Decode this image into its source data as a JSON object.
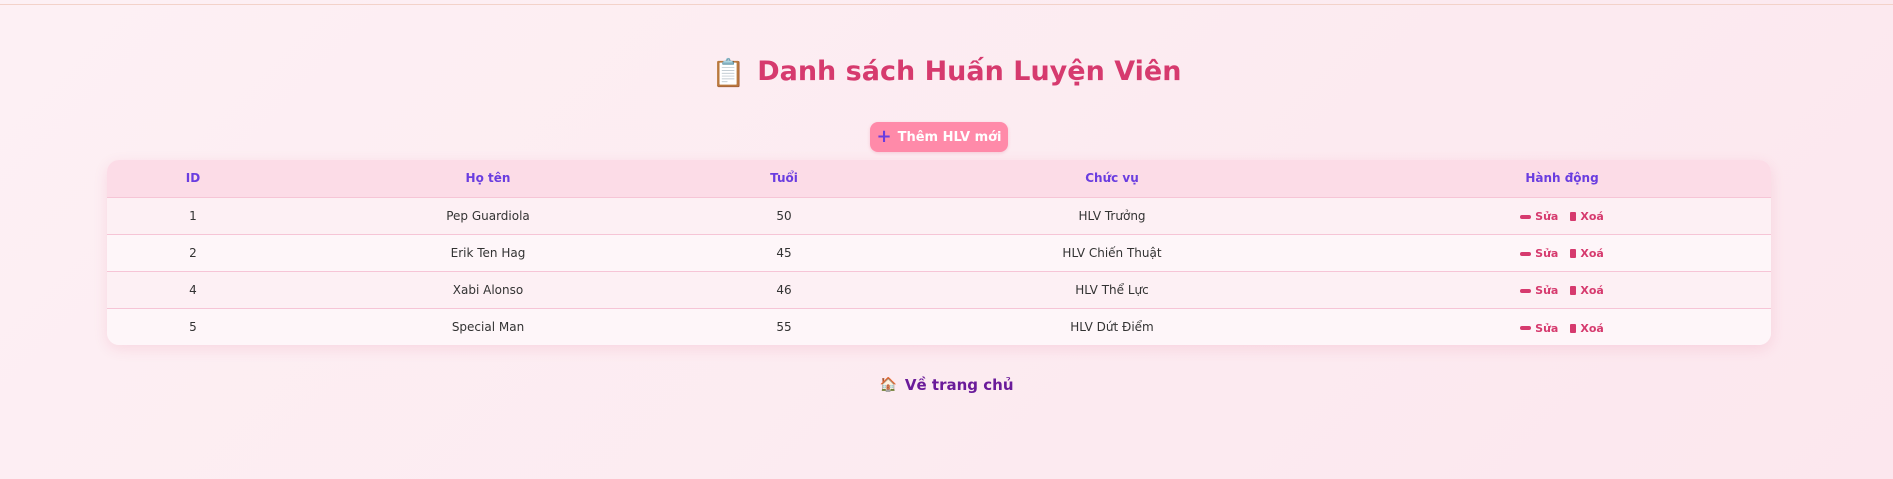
{
  "header": {
    "title": "Danh sách Huấn Luyện Viên",
    "title_icon": "📋"
  },
  "actions": {
    "add_label": "Thêm HLV mới",
    "add_icon": "+"
  },
  "table": {
    "columns": [
      "ID",
      "Họ tên",
      "Tuổi",
      "Chức vụ",
      "Hành động"
    ],
    "rows": [
      {
        "id": "1",
        "name": "Pep Guardiola",
        "age": "50",
        "role": "HLV Trưởng"
      },
      {
        "id": "2",
        "name": "Erik Ten Hag",
        "age": "45",
        "role": "HLV Chiến Thuật"
      },
      {
        "id": "4",
        "name": "Xabi Alonso",
        "age": "46",
        "role": "HLV Thể Lực"
      },
      {
        "id": "5",
        "name": "Special Man",
        "age": "55",
        "role": "HLV Dứt Điểm"
      }
    ],
    "edit_label": "Sửa",
    "delete_label": "Xoá"
  },
  "footer": {
    "home_label": "Về trang chủ",
    "home_icon": "🏠"
  },
  "colors": {
    "accent": "#d63a6e",
    "header_text": "#6a3de0",
    "button_bg": "#ff8aa9",
    "home_link": "#6a1b9a"
  }
}
